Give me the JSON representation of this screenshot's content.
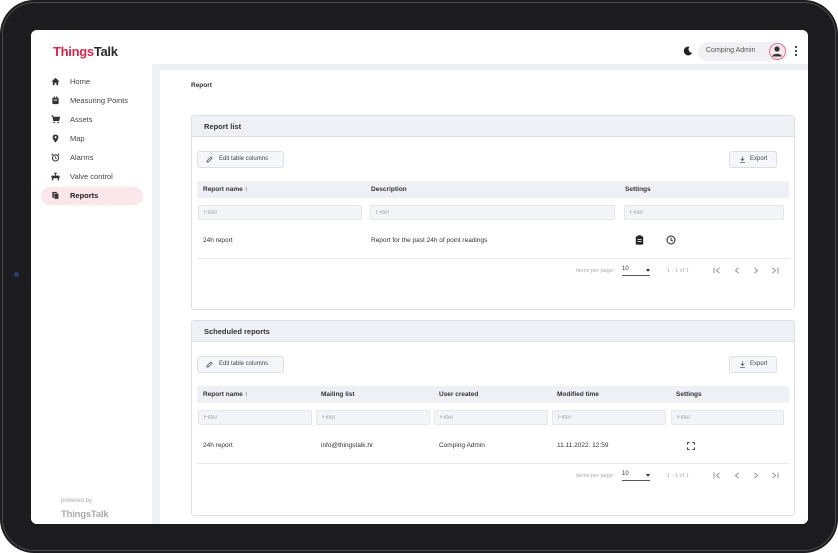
{
  "header": {
    "logo_part1": "Things",
    "logo_part2": "Talk",
    "user_name": "Comping Admin"
  },
  "sidebar": {
    "items": [
      {
        "label": "Home",
        "icon": "home-icon"
      },
      {
        "label": "Measuring Points",
        "icon": "measuring-point-icon"
      },
      {
        "label": "Assets",
        "icon": "cart-icon"
      },
      {
        "label": "Map",
        "icon": "map-pin-icon"
      },
      {
        "label": "Alarms",
        "icon": "alarm-clock-icon"
      },
      {
        "label": "Valve control",
        "icon": "valve-icon"
      },
      {
        "label": "Reports",
        "icon": "reports-icon",
        "active": true
      }
    ],
    "powered_by": "powered by",
    "powered_logo": "ThingsTalk"
  },
  "breadcrumb": "Report",
  "report_list": {
    "title": "Report list",
    "edit_columns_label": "Edit table columns",
    "export_label": "Export",
    "columns": [
      "Report name",
      "Description",
      "Settings"
    ],
    "sort_arrow": "↑",
    "filter_placeholder": "Filter",
    "rows": [
      {
        "name": "24h report",
        "description": "Report for the past 24h of point readings"
      }
    ],
    "items_per_page_label": "Items per page:",
    "items_per_page": "10",
    "range": "1 - 1 of 1"
  },
  "scheduled": {
    "title": "Scheduled reports",
    "edit_columns_label": "Edit table columns",
    "export_label": "Export",
    "columns": [
      "Report name",
      "Mailing list",
      "User created",
      "Modified time",
      "Settings"
    ],
    "sort_arrow": "↑",
    "filter_placeholder": "Filter",
    "rows": [
      {
        "name": "24h report",
        "mailing": "info@thingstalk.hr",
        "user": "Comping Admin",
        "modified": "11.11.2022. 12:59"
      }
    ],
    "items_per_page_label": "Items per page:",
    "items_per_page": "10",
    "range": "1 - 1 of 1"
  },
  "colors": {
    "brand": "#d2284e",
    "active_bg": "#fbe6ec",
    "panel_bg": "#eff0f5"
  }
}
